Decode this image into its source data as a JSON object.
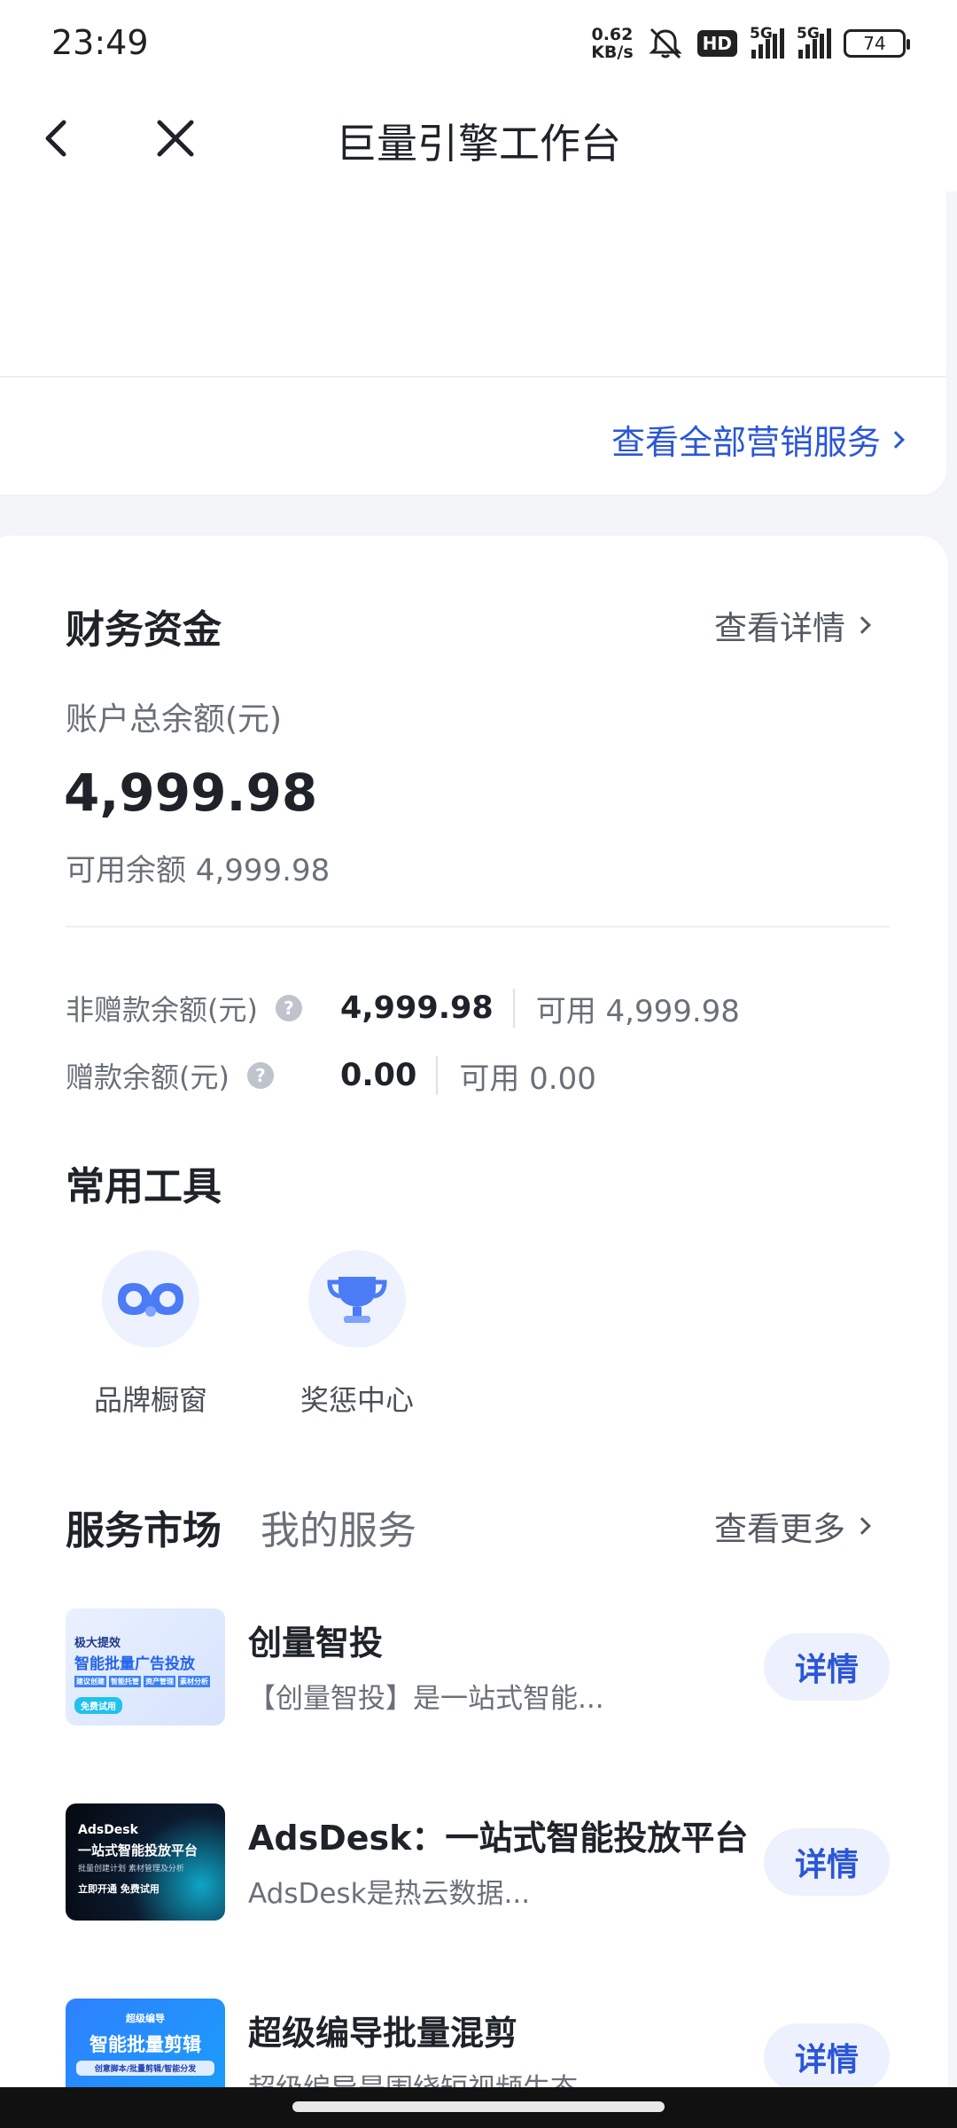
{
  "status_bar": {
    "time": "23:49",
    "net_speed_value": "0.62",
    "net_speed_unit": "KB/s",
    "hd_label": "HD",
    "signal_1_label": "5G",
    "signal_2_label": "5G",
    "battery": "74",
    "icons": [
      "mute-bell-icon",
      "signal-icon",
      "battery-icon"
    ]
  },
  "nav": {
    "title": "巨量引擎工作台",
    "icons": [
      "back-arrow-icon",
      "close-icon"
    ]
  },
  "top_card": {
    "view_all_services": "查看全部营销服务"
  },
  "finance": {
    "title": "财务资金",
    "view_details": "查看详情",
    "total_label": "账户总余额(元)",
    "total_value": "4,999.98",
    "available_text": "可用余额 4,999.98",
    "rows": [
      {
        "label": "非赠款余额(元)",
        "value": "4,999.98",
        "available": "可用 4,999.98"
      },
      {
        "label": "赠款余额(元)",
        "value": "0.00",
        "available": "可用 0.00"
      }
    ],
    "help_glyph": "?"
  },
  "tools": {
    "title": "常用工具",
    "items": [
      {
        "label": "品牌橱窗",
        "icon": "brand-window-icon"
      },
      {
        "label": "奖惩中心",
        "icon": "trophy-icon"
      }
    ]
  },
  "services": {
    "tab_market": "服务市场",
    "tab_mine": "我的服务",
    "view_more": "查看更多",
    "items": [
      {
        "name": "创量智投",
        "desc": "【创量智投】是一站式智能...",
        "button": "详情",
        "thumb": {
          "line1": "极大提效",
          "line2": "智能批量广告投放",
          "tags": [
            "建议创建",
            "智能托管",
            "资产管理",
            "素材分析"
          ],
          "cta": "免费试用"
        }
      },
      {
        "name": "AdsDesk：一站式智能投放平台",
        "desc": "AdsDesk是热云数据...",
        "button": "详情",
        "thumb": {
          "line1": "AdsDesk",
          "line2": "一站式智能投放平台",
          "line3": "批量创建计划 素材管理及分析",
          "line4": "立即开通 免费试用"
        }
      },
      {
        "name": "超级编导批量混剪",
        "desc": "超级编导是围绕短视频生态",
        "button": "详情",
        "thumb": {
          "line1": "超级编导",
          "line2": "智能批量剪辑",
          "line3": "创意脚本/批量剪辑/智能分发"
        }
      }
    ]
  },
  "colors": {
    "accent": "#2b56d6",
    "button_bg": "#edf1fd",
    "page_bg": "#f4f5f8",
    "text_primary": "#1f2329",
    "text_secondary": "#6b7078"
  }
}
